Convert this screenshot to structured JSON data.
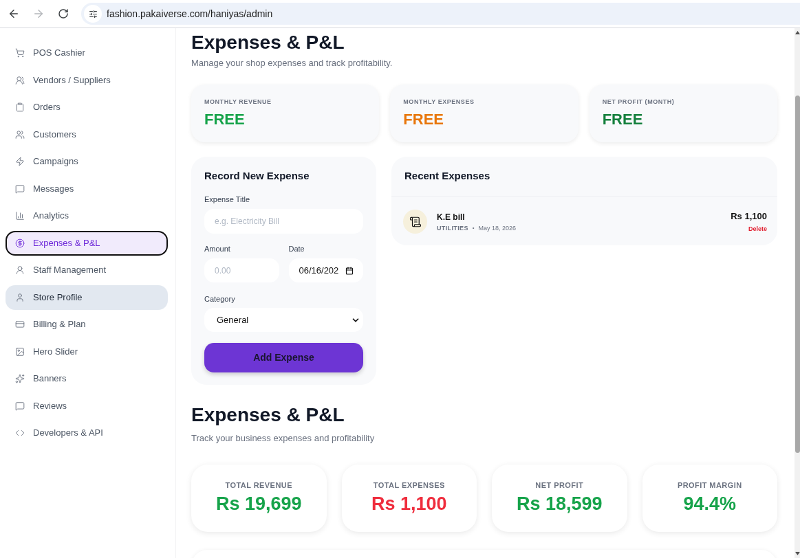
{
  "browser": {
    "url": "fashion.pakaiverse.com/haniyas/admin",
    "forward_disabled": true
  },
  "sidebar": {
    "items": [
      {
        "label": "POS Cashier",
        "selected": false,
        "hovered": false
      },
      {
        "label": "Vendors / Suppliers",
        "selected": false,
        "hovered": false
      },
      {
        "label": "Orders",
        "selected": false,
        "hovered": false
      },
      {
        "label": "Customers",
        "selected": false,
        "hovered": false
      },
      {
        "label": "Campaigns",
        "selected": false,
        "hovered": false
      },
      {
        "label": "Messages",
        "selected": false,
        "hovered": false
      },
      {
        "label": "Analytics",
        "selected": false,
        "hovered": false
      },
      {
        "label": "Expenses & P&L",
        "selected": true,
        "hovered": false
      },
      {
        "label": "Staff Management",
        "selected": false,
        "hovered": false
      },
      {
        "label": "Store Profile",
        "selected": false,
        "hovered": true
      },
      {
        "label": "Billing & Plan",
        "selected": false,
        "hovered": false
      },
      {
        "label": "Hero Slider",
        "selected": false,
        "hovered": false
      },
      {
        "label": "Banners",
        "selected": false,
        "hovered": false
      },
      {
        "label": "Reviews",
        "selected": false,
        "hovered": false
      },
      {
        "label": "Developers & API",
        "selected": false,
        "hovered": false
      }
    ]
  },
  "header": {
    "title": "Expenses & P&L",
    "subtitle": "Manage your shop expenses and track profitability."
  },
  "monthly_stats": [
    {
      "label": "MONTHLY REVENUE",
      "value": "FREE",
      "color": "#16a34a"
    },
    {
      "label": "MONTHLY EXPENSES",
      "value": "FREE",
      "color": "#e8760a"
    },
    {
      "label": "NET PROFIT (MONTH)",
      "value": "FREE",
      "color": "#15803d"
    }
  ],
  "expense_form": {
    "title": "Record New Expense",
    "expense_title": {
      "label": "Expense Title",
      "placeholder": "e.g. Electricity Bill"
    },
    "amount": {
      "label": "Amount",
      "placeholder": "0.00"
    },
    "date": {
      "label": "Date",
      "value": "06/16/202"
    },
    "category": {
      "label": "Category",
      "value": "General"
    },
    "submit": "Add Expense"
  },
  "recent_expenses": {
    "title": "Recent Expenses",
    "items": [
      {
        "title": "K.E bill",
        "category": "UTILITIES",
        "separator": "•",
        "date": "May 18, 2026",
        "amount": "Rs 1,100",
        "action": "Delete"
      }
    ]
  },
  "summary": {
    "title": "Expenses & P&L",
    "subtitle": "Track your business expenses and profitability",
    "cards": [
      {
        "label": "TOTAL REVENUE",
        "value": "Rs 19,699",
        "color": "#16a34a"
      },
      {
        "label": "TOTAL EXPENSES",
        "value": "Rs 1,100",
        "color": "#ef2d3d"
      },
      {
        "label": "NET PROFIT",
        "value": "Rs 18,599",
        "color": "#16a34a"
      },
      {
        "label": "PROFIT MARGIN",
        "value": "94.4%",
        "color": "#16a34a"
      }
    ]
  }
}
